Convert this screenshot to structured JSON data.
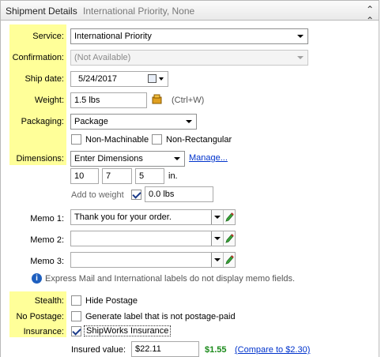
{
  "header": {
    "title": "Shipment Details",
    "summary": "International Priority, None"
  },
  "labels": {
    "service": "Service:",
    "confirmation": "Confirmation:",
    "ship_date": "Ship date:",
    "weight": "Weight:",
    "packaging": "Packaging:",
    "dimensions": "Dimensions:",
    "memo1": "Memo 1:",
    "memo2": "Memo 2:",
    "memo3": "Memo 3:",
    "stealth": "Stealth:",
    "no_postage": "No Postage:",
    "insurance": "Insurance:"
  },
  "service": {
    "value": "International Priority"
  },
  "confirmation": {
    "value": "(Not Available)"
  },
  "ship_date": {
    "value": "5/24/2017"
  },
  "weight": {
    "value": "1.5 lbs",
    "shortcut": "(Ctrl+W)"
  },
  "packaging": {
    "value": "Package",
    "non_machinable": "Non-Machinable",
    "non_rectangular": "Non-Rectangular"
  },
  "dimensions": {
    "value": "Enter Dimensions",
    "manage": "Manage...",
    "length": "10",
    "width": "7",
    "height": "5",
    "unit": "in.",
    "add_to_weight": "Add to weight",
    "add_weight_value": "0.0 lbs"
  },
  "memos": {
    "memo1": "Thank you for your order.",
    "memo2": "",
    "memo3": ""
  },
  "memo_note": "Express Mail and International labels do not display memo fields.",
  "stealth": {
    "label": "Hide Postage"
  },
  "no_postage": {
    "label": "Generate label that is not postage-paid"
  },
  "insurance": {
    "label": "ShipWorks Insurance",
    "insured_value_label": "Insured value:",
    "insured_value": "$22.11",
    "cost": "$1.55",
    "compare": "(Compare to $2.30)"
  },
  "colors": {
    "highlight": "#ffff99",
    "link": "#0033cc",
    "price": "#1a8a1a"
  }
}
